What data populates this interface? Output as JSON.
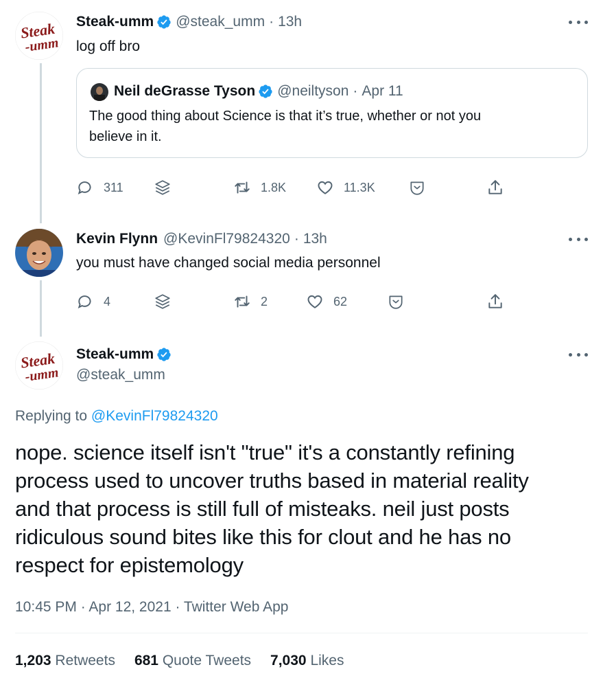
{
  "tweet1": {
    "author_logo_text": [
      "Steak",
      "-umm"
    ],
    "name": "Steak-umm",
    "handle": "@steak_umm",
    "time": "13h",
    "text": "log off bro",
    "quote": {
      "name": "Neil deGrasse Tyson",
      "handle": "@neiltyson",
      "time": "Apr 11",
      "text_line1": "The good thing about Science is that it’s true, whether or not you",
      "text_line2": "believe in it."
    },
    "actions": {
      "replies": "311",
      "retweets": "1.8K",
      "likes": "11.3K"
    }
  },
  "tweet2": {
    "name": "Kevin Flynn",
    "handle": "@KevinFl79824320",
    "time": "13h",
    "text": "you must have changed social media personnel",
    "actions": {
      "replies": "4",
      "retweets": "2",
      "likes": "62"
    }
  },
  "main": {
    "name": "Steak-umm",
    "handle": "@steak_umm",
    "replying_prefix": "Replying to",
    "replying_to": "@KevinFl79824320",
    "text_lines": [
      "nope. science itself isn't \"true\" it's a constantly refining",
      "process used to uncover truths based in material reality",
      "and that process is still full of misteaks. neil just posts",
      "ridiculous sound bites like this for clout and he has no",
      "respect for epistemology"
    ],
    "timestamp": "10:45 PM · Apr 12, 2021 · Twitter Web App",
    "stats": {
      "retweets_count": "1,203",
      "retweets_label": "Retweets",
      "quotes_count": "681",
      "quotes_label": "Quote Tweets",
      "likes_count": "7,030",
      "likes_label": "Likes"
    }
  },
  "separator": "·",
  "colors": {
    "accent": "#1d9bf0",
    "muted": "#536471",
    "text": "#0f1419",
    "steak_logo": "#8b1a1a",
    "border": "#cfd9de"
  },
  "icons": [
    "verified-badge-icon",
    "more-icon",
    "reply-icon",
    "stack-icon",
    "retweet-icon",
    "like-icon",
    "tip-jar-icon",
    "share-icon"
  ]
}
